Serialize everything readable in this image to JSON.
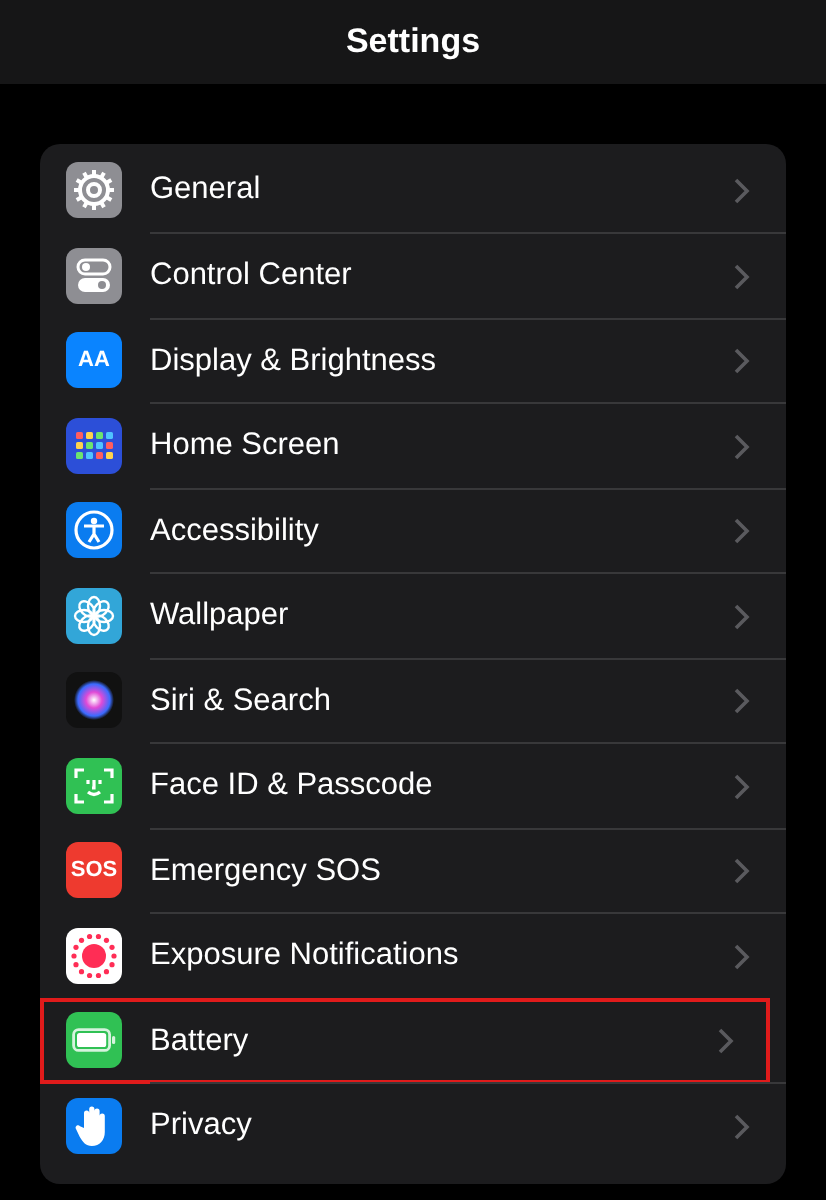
{
  "header": {
    "title": "Settings"
  },
  "rows": [
    {
      "label": "General",
      "kind": "gear",
      "color": "#8e8e93",
      "highlighted": false
    },
    {
      "label": "Control Center",
      "kind": "toggles",
      "color": "#8e8e93",
      "highlighted": false
    },
    {
      "label": "Display & Brightness",
      "kind": "letters",
      "icon_text": "AA",
      "color": "#0a84ff",
      "highlighted": false
    },
    {
      "label": "Home Screen",
      "kind": "grid",
      "color": "#2c4fd8",
      "highlighted": false
    },
    {
      "label": "Accessibility",
      "kind": "figure",
      "color": "#0a7cf0",
      "highlighted": false
    },
    {
      "label": "Wallpaper",
      "kind": "flower",
      "color": "#32a6d8",
      "highlighted": false
    },
    {
      "label": "Siri & Search",
      "kind": "orb",
      "color": "#111111",
      "highlighted": false
    },
    {
      "label": "Face ID & Passcode",
      "kind": "face",
      "color": "#30c154",
      "highlighted": false
    },
    {
      "label": "Emergency SOS",
      "kind": "letters",
      "icon_text": "SOS",
      "color": "#ee3a2f",
      "highlighted": false
    },
    {
      "label": "Exposure Notifications",
      "kind": "dots",
      "color": "#ffffff",
      "highlighted": false
    },
    {
      "label": "Battery",
      "kind": "battery",
      "color": "#30c154",
      "highlighted": true
    },
    {
      "label": "Privacy",
      "kind": "hand",
      "color": "#0a7cf0",
      "highlighted": false
    }
  ]
}
